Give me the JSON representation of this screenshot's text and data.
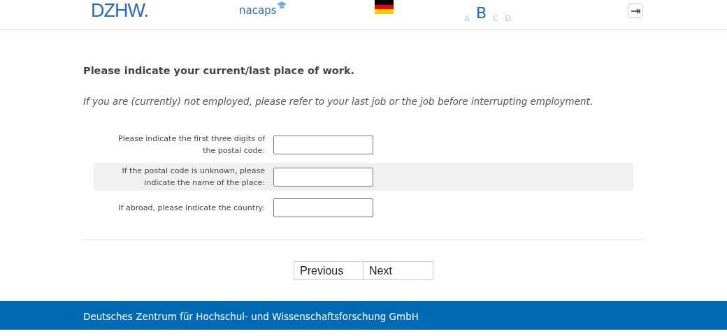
{
  "header": {
    "logo": "DZHW.",
    "brand": "nacaps",
    "font_sizes": [
      {
        "label": "A",
        "selected": false
      },
      {
        "label": "B",
        "selected": true
      },
      {
        "label": "C",
        "selected": false
      },
      {
        "label": "D",
        "selected": false
      }
    ]
  },
  "question": {
    "title": "Please indicate your current/last place of work.",
    "instruction": "If you are (currently) not employed, please refer to your last job or the job before interrupting employment."
  },
  "fields": [
    {
      "label": "Please indicate the first three digits of the postal code:"
    },
    {
      "label": "If the postal code is unknown, please indicate the name of the place:"
    },
    {
      "label": "If abroad, please indicate the country:"
    }
  ],
  "buttons": [
    "Previous",
    "Next"
  ],
  "footer": "Deutsches Zentrum für Hochschul- und Wissenschaftsforschung GmbH"
}
